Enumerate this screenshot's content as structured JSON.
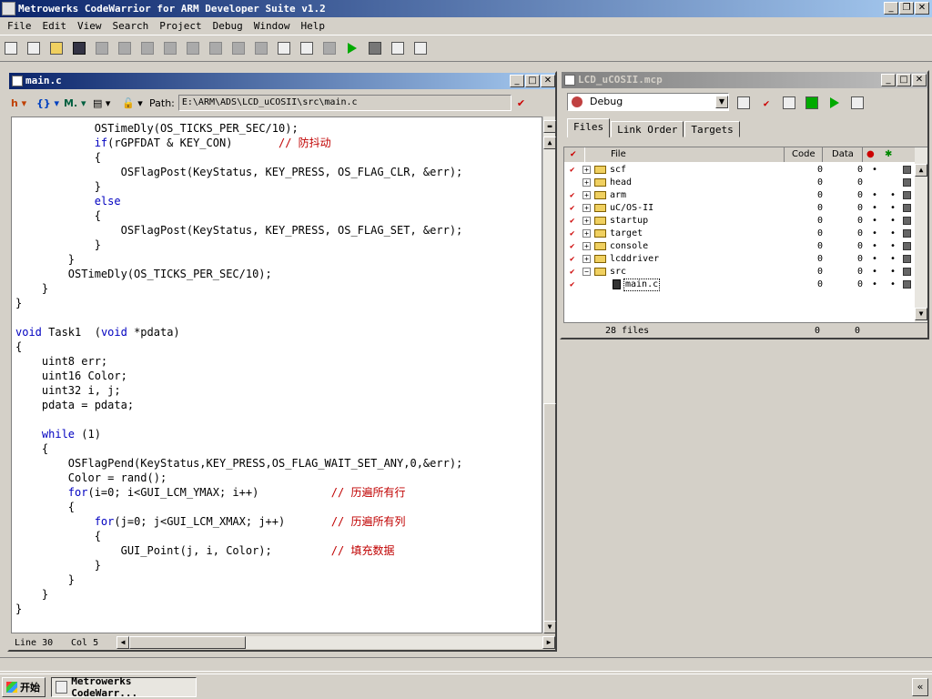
{
  "app": {
    "title": "Metrowerks CodeWarrior for ARM Developer Suite v1.2"
  },
  "menu": [
    "File",
    "Edit",
    "View",
    "Search",
    "Project",
    "Debug",
    "Window",
    "Help"
  ],
  "editor": {
    "title": "main.c",
    "path_label": "Path:",
    "path": "E:\\ARM\\ADS\\LCD_uCOSII\\src\\main.c",
    "status_line": "Line 30",
    "status_col": "Col 5",
    "lines": [
      {
        "indent": "            ",
        "parts": [
          {
            "t": "OSTimeDly(OS_TICKS_PER_SEC/10);"
          }
        ]
      },
      {
        "indent": "            ",
        "parts": [
          {
            "t": "if",
            "c": "kw"
          },
          {
            "t": "(rGPFDAT & KEY_CON)       "
          },
          {
            "t": "// 防抖动",
            "c": "cm"
          }
        ]
      },
      {
        "indent": "            ",
        "parts": [
          {
            "t": "{"
          }
        ]
      },
      {
        "indent": "                ",
        "parts": [
          {
            "t": "OSFlagPost(KeyStatus, KEY_PRESS, OS_FLAG_CLR, &err);"
          }
        ]
      },
      {
        "indent": "            ",
        "parts": [
          {
            "t": "}"
          }
        ]
      },
      {
        "indent": "            ",
        "parts": [
          {
            "t": "else",
            "c": "kw"
          }
        ]
      },
      {
        "indent": "            ",
        "parts": [
          {
            "t": "{"
          }
        ]
      },
      {
        "indent": "                ",
        "parts": [
          {
            "t": "OSFlagPost(KeyStatus, KEY_PRESS, OS_FLAG_SET, &err);"
          }
        ]
      },
      {
        "indent": "            ",
        "parts": [
          {
            "t": "}"
          }
        ]
      },
      {
        "indent": "        ",
        "parts": [
          {
            "t": "}"
          }
        ]
      },
      {
        "indent": "        ",
        "parts": [
          {
            "t": "OSTimeDly(OS_TICKS_PER_SEC/10);"
          }
        ]
      },
      {
        "indent": "    ",
        "parts": [
          {
            "t": "}"
          }
        ]
      },
      {
        "indent": "",
        "parts": [
          {
            "t": "}"
          }
        ]
      },
      {
        "indent": "",
        "parts": [
          {
            "t": ""
          }
        ]
      },
      {
        "indent": "",
        "parts": [
          {
            "t": "void",
            "c": "kw"
          },
          {
            "t": " Task1  ("
          },
          {
            "t": "void",
            "c": "kw"
          },
          {
            "t": " *pdata)"
          }
        ]
      },
      {
        "indent": "",
        "parts": [
          {
            "t": "{"
          }
        ]
      },
      {
        "indent": "    ",
        "parts": [
          {
            "t": "uint8 err;"
          }
        ]
      },
      {
        "indent": "    ",
        "parts": [
          {
            "t": "uint16 Color;"
          }
        ]
      },
      {
        "indent": "    ",
        "parts": [
          {
            "t": "uint32 i, j;"
          }
        ]
      },
      {
        "indent": "    ",
        "parts": [
          {
            "t": "pdata = pdata;"
          }
        ]
      },
      {
        "indent": "",
        "parts": [
          {
            "t": ""
          }
        ]
      },
      {
        "indent": "    ",
        "parts": [
          {
            "t": "while",
            "c": "kw"
          },
          {
            "t": " (1)"
          }
        ]
      },
      {
        "indent": "    ",
        "parts": [
          {
            "t": "{"
          }
        ]
      },
      {
        "indent": "        ",
        "parts": [
          {
            "t": "OSFlagPend(KeyStatus,KEY_PRESS,OS_FLAG_WAIT_SET_ANY,0,&err);"
          }
        ]
      },
      {
        "indent": "        ",
        "parts": [
          {
            "t": "Color = rand();"
          }
        ]
      },
      {
        "indent": "        ",
        "parts": [
          {
            "t": "for",
            "c": "kw"
          },
          {
            "t": "(i=0; i<GUI_LCM_YMAX; i++)           "
          },
          {
            "t": "// 历遍所有行",
            "c": "cm"
          }
        ]
      },
      {
        "indent": "        ",
        "parts": [
          {
            "t": "{"
          }
        ]
      },
      {
        "indent": "            ",
        "parts": [
          {
            "t": "for",
            "c": "kw"
          },
          {
            "t": "(j=0; j<GUI_LCM_XMAX; j++)       "
          },
          {
            "t": "// 历遍所有列",
            "c": "cm"
          }
        ]
      },
      {
        "indent": "            ",
        "parts": [
          {
            "t": "{"
          }
        ]
      },
      {
        "indent": "                ",
        "parts": [
          {
            "t": "GUI_Point(j, i, Color);         "
          },
          {
            "t": "// 填充数据",
            "c": "cm"
          }
        ]
      },
      {
        "indent": "            ",
        "parts": [
          {
            "t": "}"
          }
        ]
      },
      {
        "indent": "        ",
        "parts": [
          {
            "t": "}"
          }
        ]
      },
      {
        "indent": "    ",
        "parts": [
          {
            "t": "}"
          }
        ]
      },
      {
        "indent": "",
        "parts": [
          {
            "t": "}"
          }
        ]
      }
    ]
  },
  "project": {
    "title": "LCD_uCOSII.mcp",
    "target": "Debug",
    "tabs": [
      "Files",
      "Link Order",
      "Targets"
    ],
    "columns": {
      "file": "File",
      "code": "Code",
      "data": "Data"
    },
    "files": [
      {
        "name": "scf",
        "type": "folder",
        "code": "0",
        "data": "0",
        "checked": true,
        "dot1": true,
        "dot2": false
      },
      {
        "name": "head",
        "type": "folder",
        "code": "0",
        "data": "0",
        "checked": false,
        "dot1": false,
        "dot2": false
      },
      {
        "name": "arm",
        "type": "folder",
        "code": "0",
        "data": "0",
        "checked": true,
        "dot1": true,
        "dot2": true
      },
      {
        "name": "uC/OS-II",
        "type": "folder",
        "code": "0",
        "data": "0",
        "checked": true,
        "dot1": true,
        "dot2": true
      },
      {
        "name": "startup",
        "type": "folder",
        "code": "0",
        "data": "0",
        "checked": true,
        "dot1": true,
        "dot2": true
      },
      {
        "name": "target",
        "type": "folder",
        "code": "0",
        "data": "0",
        "checked": true,
        "dot1": true,
        "dot2": true
      },
      {
        "name": "console",
        "type": "folder",
        "code": "0",
        "data": "0",
        "checked": true,
        "dot1": true,
        "dot2": true
      },
      {
        "name": "lcddriver",
        "type": "folder",
        "code": "0",
        "data": "0",
        "checked": true,
        "dot1": true,
        "dot2": true
      },
      {
        "name": "src",
        "type": "folder-open",
        "code": "0",
        "data": "0",
        "checked": true,
        "dot1": true,
        "dot2": true
      },
      {
        "name": "main.c",
        "type": "file",
        "code": "0",
        "data": "0",
        "checked": true,
        "dot1": true,
        "dot2": true
      }
    ],
    "footer": {
      "count": "28 files",
      "code": "0",
      "data": "0"
    }
  },
  "taskbar": {
    "start": "开始",
    "task": "Metrowerks CodeWarr..."
  }
}
